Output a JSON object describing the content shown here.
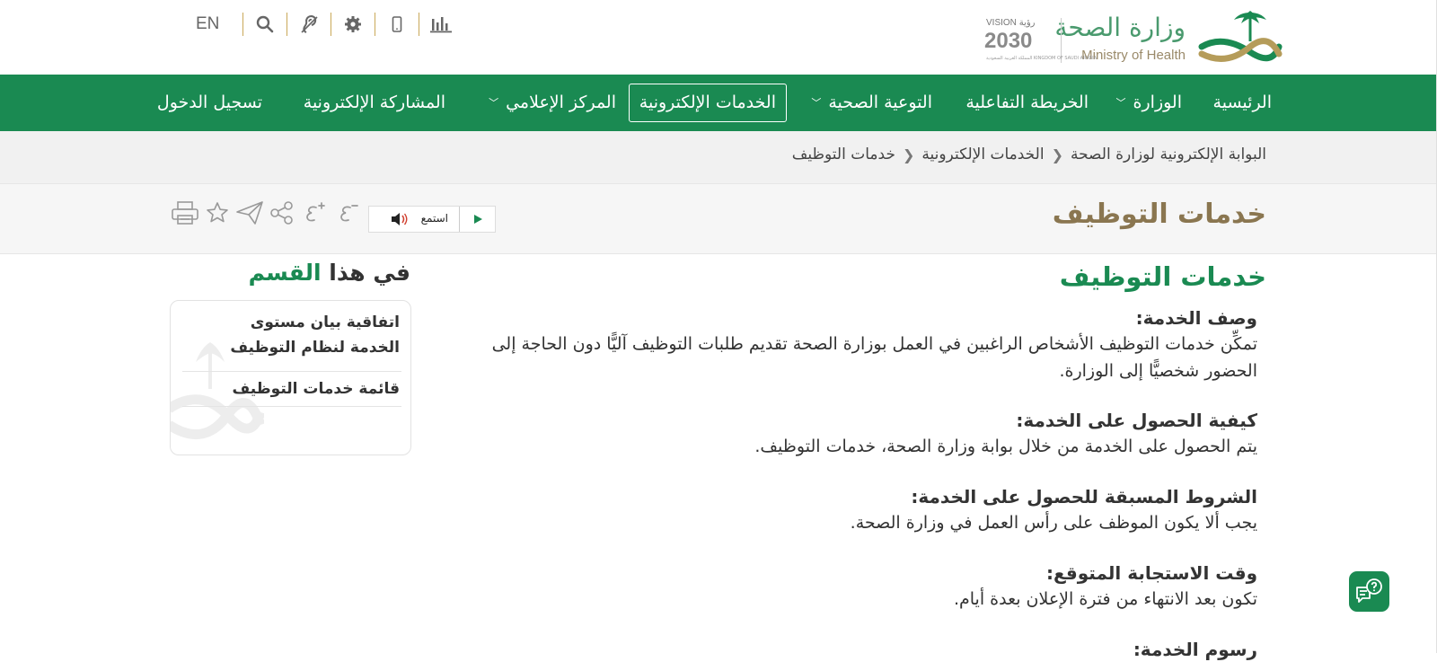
{
  "logo": {
    "arabic": "وزارة الصحة",
    "english": "Ministry of Health",
    "vision_top": "VISION رؤية",
    "vision_year": "2030",
    "vision_sub": "المملكة العربية السعودية KINGDOM OF SAUDI ARABIA"
  },
  "toolbar": {
    "language": "EN",
    "icons": [
      "search-icon",
      "hearing-icon",
      "settings-icon",
      "mobile-icon",
      "stats-icon"
    ]
  },
  "nav": {
    "items": [
      {
        "label": "الرئيسية",
        "dropdown": false
      },
      {
        "label": "الوزارة",
        "dropdown": true
      },
      {
        "label": "الخريطة التفاعلية",
        "dropdown": false
      },
      {
        "label": "التوعية الصحية",
        "dropdown": true
      },
      {
        "label": "الخدمات الإلكترونية",
        "dropdown": false,
        "active": true
      },
      {
        "label": "المركز الإعلامي",
        "dropdown": true
      },
      {
        "label": "المشاركة الإلكترونية",
        "dropdown": false
      },
      {
        "label": "تسجيل الدخول",
        "dropdown": false
      }
    ]
  },
  "breadcrumb": {
    "items": [
      "البوابة الإلكترونية لوزارة الصحة",
      "الخدمات الإلكترونية",
      "خدمات التوظيف"
    ]
  },
  "page": {
    "title": "خدمات التوظيف",
    "listen_label": "استمع",
    "share_icons": [
      "font-decrease-icon",
      "font-increase-icon",
      "share-icon",
      "send-icon",
      "favorite-icon",
      "print-icon"
    ]
  },
  "content": {
    "heading": "خدمات التوظيف",
    "sections": [
      {
        "title": "وصف الخدمة:",
        "text": "تمكِّن خدمات التوظيف الأشخاص الراغبين في العمل بوزارة الصحة تقديم طلبات التوظيف آليًّا دون الحاجة إلى الحضور شخصيًّا إلى الوزارة."
      },
      {
        "title": "كيفية الحصول على الخدمة:",
        "text": "يتم الحصول على الخدمة من خلال بوابة وزارة الصحة، خدمات التوظيف."
      },
      {
        "title": "الشروط المسبقة للحصول على الخدمة:",
        "text": "يجب ألا يكون الموظف على رأس العمل في وزارة الصحة."
      },
      {
        "title": "وقت الاستجابة المتوقع:",
        "text": "تكون بعد الانتهاء من فترة الإعلان بعدة أيام."
      },
      {
        "title": "رسوم الخدمة:",
        "text": ""
      }
    ]
  },
  "sidebar": {
    "title_prefix": "في هذا",
    "title_accent": "القسم",
    "links": [
      "اتفاقية بيان مستوى الخدمة لنظام التوظيف",
      "قائمة خدمات التوظيف"
    ]
  },
  "colors": {
    "primary_green": "#1a8a52",
    "title_brown": "#8a7650",
    "gold_separator": "#c9a858"
  }
}
